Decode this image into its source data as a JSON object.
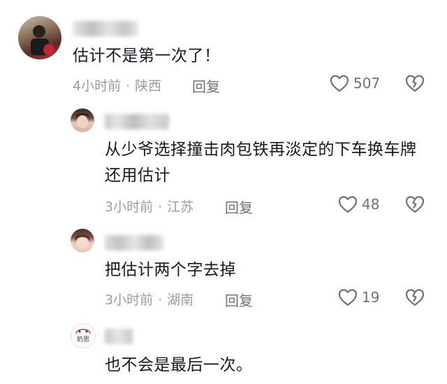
{
  "comments": [
    {
      "username": "",
      "text": "估计不是第一次了！",
      "time": "4小时前",
      "location": "陕西",
      "reply_label": "回复",
      "likes": "507"
    },
    {
      "username": "",
      "text": "从少爷选择撞击肉包铁再淡定的下车换车牌 还用估计",
      "time": "3小时前",
      "location": "江苏",
      "reply_label": "回复",
      "likes": "48"
    },
    {
      "username": "",
      "text": "把估计两个字去掉",
      "time": "3小时前",
      "location": "湖南",
      "reply_label": "回复",
      "likes": "19"
    },
    {
      "username": "",
      "text": "也不会是最后一次。",
      "avatar_text": "奶思"
    }
  ],
  "colors": {
    "meta_gray": "#9b9ca4",
    "icon_gray": "#6f7079",
    "text": "#161823"
  }
}
